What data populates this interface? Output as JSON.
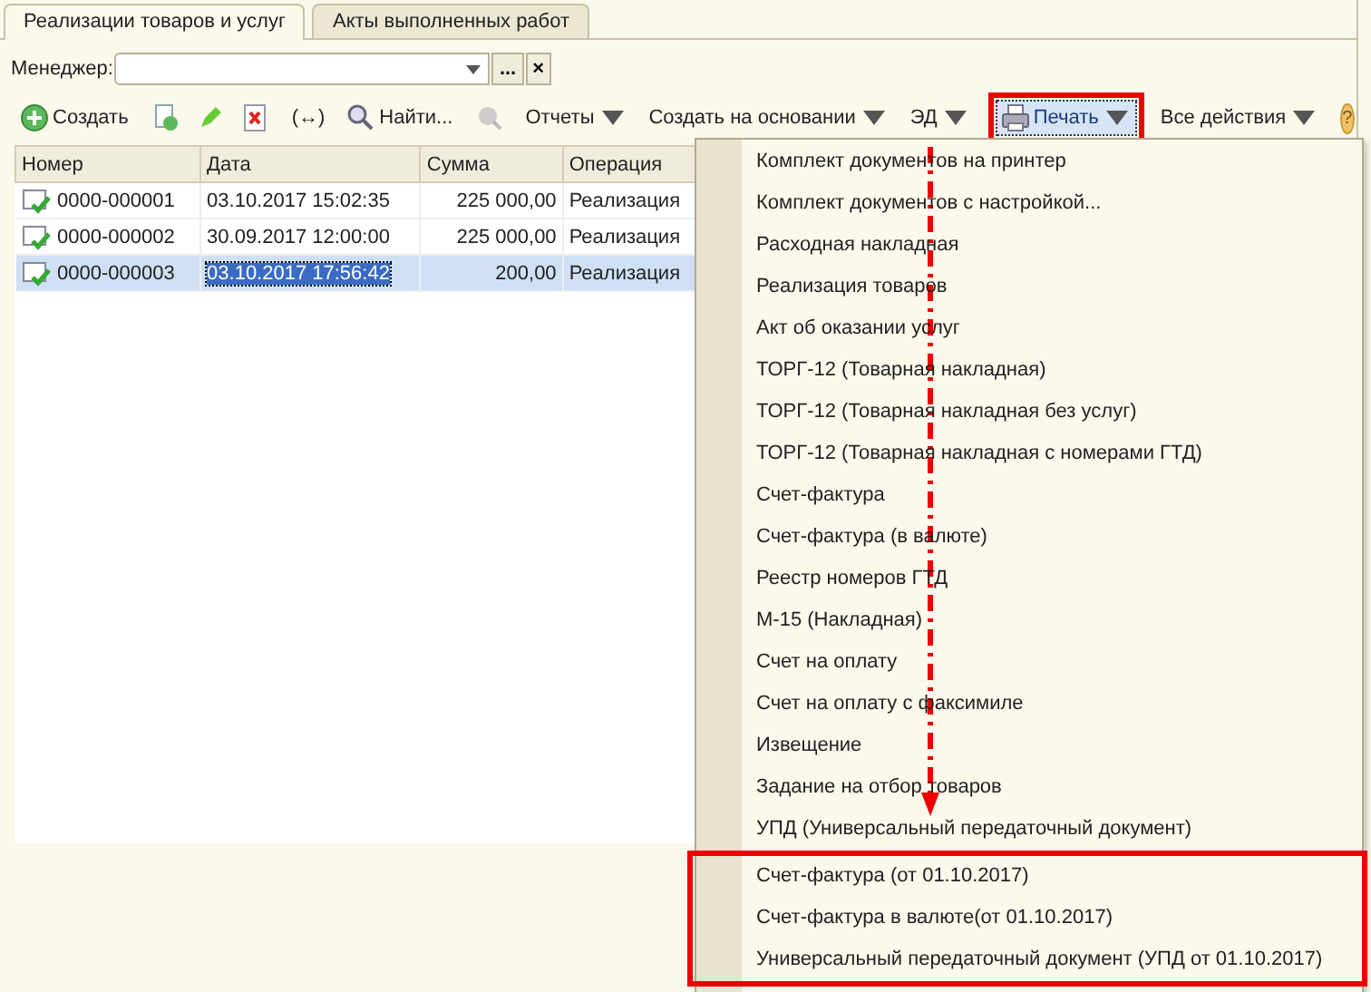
{
  "tabs": [
    {
      "label": "Реализации товаров и услуг",
      "selected": true
    },
    {
      "label": "Акты выполненных работ",
      "selected": false
    }
  ],
  "manager": {
    "label": "Менеджер:",
    "buttons": [
      "...",
      "×"
    ]
  },
  "toolbar": [
    {
      "kind": "create",
      "label": "Создать"
    },
    {
      "kind": "sep"
    },
    {
      "kind": "copy"
    },
    {
      "kind": "edit"
    },
    {
      "kind": "delete"
    },
    {
      "kind": "sep"
    },
    {
      "kind": "button",
      "label": "(↔)"
    },
    {
      "kind": "sep"
    },
    {
      "kind": "find",
      "label": "Найти..."
    },
    {
      "kind": "sep"
    },
    {
      "kind": "clear"
    },
    {
      "kind": "sep"
    },
    {
      "kind": "menu",
      "label": "Отчеты"
    },
    {
      "kind": "sep"
    },
    {
      "kind": "menu",
      "label": "Создать на основании"
    },
    {
      "kind": "sep"
    },
    {
      "kind": "menu",
      "label": "ЭД"
    },
    {
      "kind": "print",
      "label": "Печать",
      "framed": true
    },
    {
      "kind": "spacer"
    },
    {
      "kind": "menu",
      "label": "Все действия"
    },
    {
      "kind": "help",
      "label": "?"
    }
  ],
  "table": {
    "columns": [
      "Номер",
      "Дата",
      "Сумма",
      "Операция"
    ],
    "rows": [
      {
        "number": "0000-000001",
        "date": "03.10.2017 15:02:35",
        "sum": "225 000,00",
        "operation": "Реализация",
        "selected": false
      },
      {
        "number": "0000-000002",
        "date": "30.09.2017 12:00:00",
        "sum": "225 000,00",
        "operation": "Реализация",
        "selected": false
      },
      {
        "number": "0000-000003",
        "date": "03.10.2017 17:56:42",
        "sum": "200,00",
        "operation": "Реализация",
        "selected": true
      }
    ]
  },
  "print_menu": {
    "items": [
      "Комплект документов на принтер",
      "Комплект документов с настройкой...",
      "Расходная накладная",
      "Реализация товаров",
      "Акт об оказании услуг",
      "ТОРГ-12 (Товарная накладная)",
      "ТОРГ-12 (Товарная накладная без услуг)",
      "ТОРГ-12 (Товарная накладная с номерами ГТД)",
      "Счет-фактура",
      "Счет-фактура (в валюте)",
      "Реестр номеров ГТД",
      "М-15 (Накладная)",
      "Счет на оплату",
      "Счет на оплату с факсимиле",
      "Извещение",
      "Задание на отбор товаров",
      "УПД (Универсальный передаточный документ)"
    ],
    "framed_items": [
      "Счет-фактура (от 01.10.2017)",
      "Счет-фактура в валюте(от 01.10.2017)",
      "Универсальный передаточный документ (УПД от 01.10.2017)"
    ]
  }
}
